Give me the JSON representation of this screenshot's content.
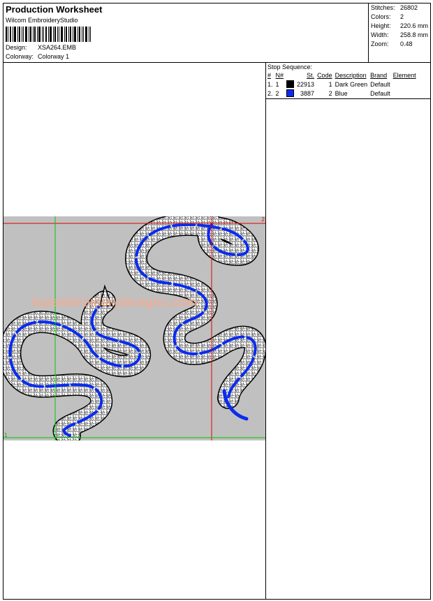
{
  "header": {
    "title": "Production Worksheet",
    "software": "Wilcom EmbroideryStudio",
    "design_label": "Design:",
    "design_value": "XSA264.EMB",
    "colorway_label": "Colorway:",
    "colorway_value": "Colorway 1"
  },
  "stats": {
    "stitches_label": "Stitches:",
    "stitches_value": "26802",
    "colors_label": "Colors:",
    "colors_value": "2",
    "height_label": "Height:",
    "height_value": "220.6 mm",
    "width_label": "Width:",
    "width_value": "258.8 mm",
    "zoom_label": "Zoom:",
    "zoom_value": "0.48"
  },
  "stop_sequence": {
    "caption": "Stop Sequence:",
    "columns": [
      "#",
      "N#",
      "St.",
      "Code",
      "Description",
      "Brand",
      "Element"
    ],
    "rows": [
      {
        "num": "1.",
        "n": "1",
        "swatch": "#000000",
        "st": "22913",
        "code": "1",
        "description": "Dark Green",
        "brand": "Default",
        "element": ""
      },
      {
        "num": "2.",
        "n": "2",
        "swatch": "#0a2cf0",
        "st": "3887",
        "code": "2",
        "description": "Blue",
        "brand": "Default",
        "element": ""
      }
    ]
  },
  "preview": {
    "watermark": "topembroiderydesigns.com",
    "marker_1": "1",
    "marker_2": "2",
    "background": "#c0c0c0",
    "thread_colors": [
      "#000000",
      "#0a2cf0"
    ],
    "guide_colors": {
      "green": "#00c800",
      "red": "#e00000"
    }
  }
}
